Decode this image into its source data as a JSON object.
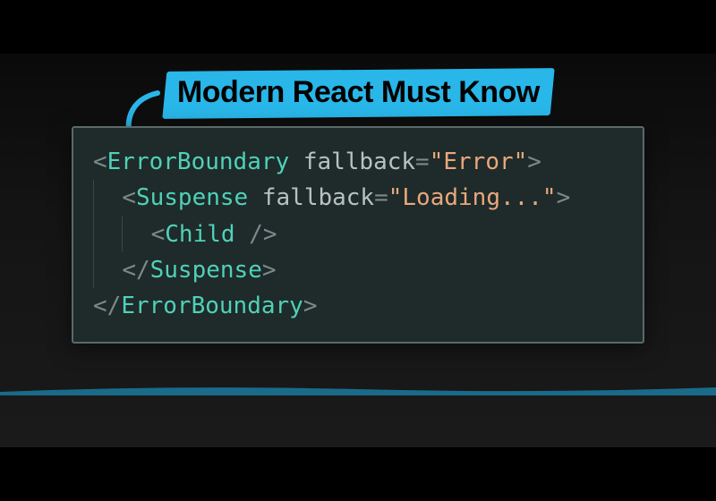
{
  "title": {
    "text": "Modern React Must Know",
    "highlight_color": "#29b6e8",
    "arrow_color": "#29b6e8"
  },
  "code": {
    "lines": [
      {
        "indent": 0,
        "tokens": [
          {
            "t": "punct",
            "v": "<"
          },
          {
            "t": "tag",
            "v": "ErrorBoundary"
          },
          {
            "t": "punct",
            "v": " "
          },
          {
            "t": "attr",
            "v": "fallback"
          },
          {
            "t": "eq",
            "v": "="
          },
          {
            "t": "str",
            "v": "\"Error\""
          },
          {
            "t": "punct",
            "v": ">"
          }
        ]
      },
      {
        "indent": 1,
        "tokens": [
          {
            "t": "punct",
            "v": "<"
          },
          {
            "t": "tag",
            "v": "Suspense"
          },
          {
            "t": "punct",
            "v": " "
          },
          {
            "t": "attr",
            "v": "fallback"
          },
          {
            "t": "eq",
            "v": "="
          },
          {
            "t": "str",
            "v": "\"Loading...\""
          },
          {
            "t": "punct",
            "v": ">"
          }
        ]
      },
      {
        "indent": 2,
        "tokens": [
          {
            "t": "punct",
            "v": "<"
          },
          {
            "t": "tag",
            "v": "Child"
          },
          {
            "t": "punct",
            "v": " />"
          }
        ]
      },
      {
        "indent": 1,
        "tokens": [
          {
            "t": "punct",
            "v": "</"
          },
          {
            "t": "tag",
            "v": "Suspense"
          },
          {
            "t": "punct",
            "v": ">"
          }
        ]
      },
      {
        "indent": 0,
        "tokens": [
          {
            "t": "punct",
            "v": "</"
          },
          {
            "t": "tag",
            "v": "ErrorBoundary"
          },
          {
            "t": "punct",
            "v": ">"
          }
        ]
      }
    ],
    "indent_unit": "  ",
    "frame_border_color": "#5a6a6a",
    "frame_bg_color": "#1f2a2a",
    "syntax_colors": {
      "punct": "#7a8a8a",
      "tag": "#4fd1b8",
      "attr": "#b8c2c2",
      "eq": "#7a8a8a",
      "str": "#e8a87c"
    }
  }
}
